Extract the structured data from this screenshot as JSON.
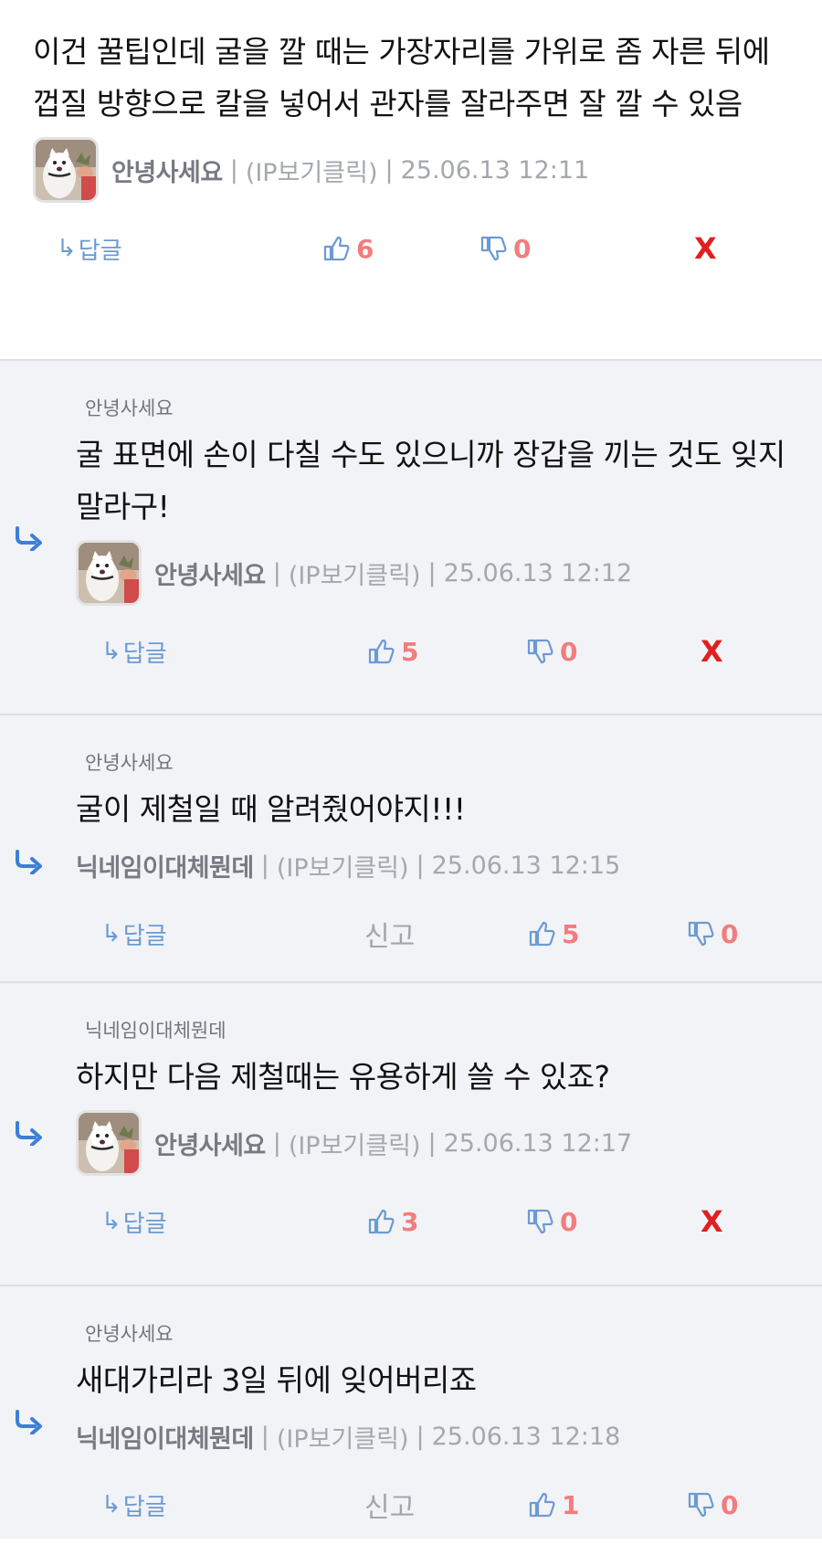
{
  "main": {
    "text": "이건 꿀팁인데 굴을 깔 때는 가장자리를 가위로 좀 자른 뒤에 껍질 방향으로 칼을 넣어서 관자를 잘라주면 잘 깔 수 있음",
    "author": "안녕사세요",
    "ip": "(IP보기클릭)",
    "date": "25.06.13 12:11",
    "reply_label": "답글",
    "likes": "6",
    "dislikes": "0",
    "delete_label": "X"
  },
  "replies": [
    {
      "parent": "안녕사세요",
      "text": "굴 표면에 손이 다칠 수도 있으니까 장갑을 끼는 것도 잊지 말라구!",
      "author": "안녕사세요",
      "ip": "(IP보기클릭)",
      "date": "25.06.13 12:12",
      "reply_label": "답글",
      "likes": "5",
      "dislikes": "0",
      "delete_label": "X"
    },
    {
      "parent": "안녕사세요",
      "text": "굴이 제철일 때 알려줬어야지!!!",
      "author": "닉네임이대체뭔데",
      "ip": "(IP보기클릭)",
      "date": "25.06.13 12:15",
      "reply_label": "답글",
      "report_label": "신고",
      "likes": "5",
      "dislikes": "0"
    },
    {
      "parent": "닉네임이대체뭔데",
      "text": "하지만 다음 제철때는 유용하게 쓸 수 있죠?",
      "author": "안녕사세요",
      "ip": "(IP보기클릭)",
      "date": "25.06.13 12:17",
      "reply_label": "답글",
      "likes": "3",
      "dislikes": "0",
      "delete_label": "X"
    },
    {
      "parent": "안녕사세요",
      "text": "새대가리라 3일 뒤에 잊어버리죠",
      "author": "닉네임이대체뭔데",
      "ip": "(IP보기클릭)",
      "date": "25.06.13 12:18",
      "reply_label": "답글",
      "report_label": "신고",
      "likes": "1",
      "dislikes": "0"
    }
  ],
  "separator": "|",
  "colors": {
    "accent_blue": "#3d7fd6",
    "count_red": "#f27d7d",
    "delete_red": "#e02020",
    "reply_bg": "#f2f3f6"
  },
  "icons": {
    "reply_arrow": "reply-arrow-icon",
    "like": "thumbs-up-icon",
    "dislike": "thumbs-down-icon",
    "avatar": "cat-avatar"
  }
}
